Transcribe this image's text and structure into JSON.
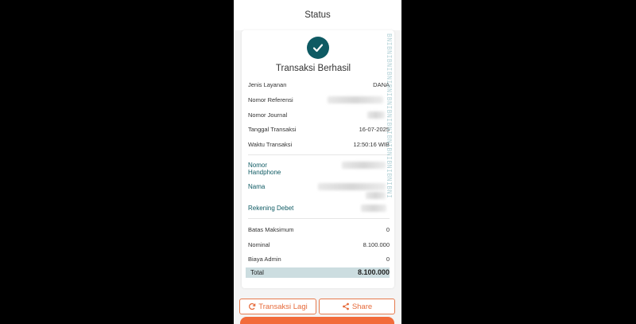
{
  "header": {
    "title": "Status"
  },
  "status": {
    "title": "Transaksi Berhasil"
  },
  "details": [
    {
      "label": "Jenis Layanan",
      "value": "DANA"
    },
    {
      "label": "Nomor Referensi",
      "value": ""
    },
    {
      "label": "Nomor Journal",
      "value": ""
    },
    {
      "label": "Tanggal Transaksi",
      "value": "16-07-2025"
    },
    {
      "label": "Waktu Transaksi",
      "value": "12:50:16 WIB"
    }
  ],
  "recipient": [
    {
      "label": "Nomor Handphone",
      "value": ""
    },
    {
      "label": "Nama",
      "value": ""
    },
    {
      "label": "Rekening Debet",
      "value": ""
    }
  ],
  "amounts": [
    {
      "label": "Batas Maksimum",
      "value": "0"
    },
    {
      "label": "Nominal",
      "value": "8.100.000"
    },
    {
      "label": "Biaya Admin",
      "value": "0"
    }
  ],
  "total": {
    "label": "Total",
    "value": "8.100.000"
  },
  "watermark": "BNIBNIBNIBNIBNIBNIBNIBNIBNIBNIBNIBNIBNI",
  "actions": {
    "repeat_label": "Transaksi Lagi",
    "share_label": "Share"
  },
  "colors": {
    "accent": "#f26b3a",
    "teal": "#0e5a63",
    "total_bg": "#ccdde0"
  }
}
